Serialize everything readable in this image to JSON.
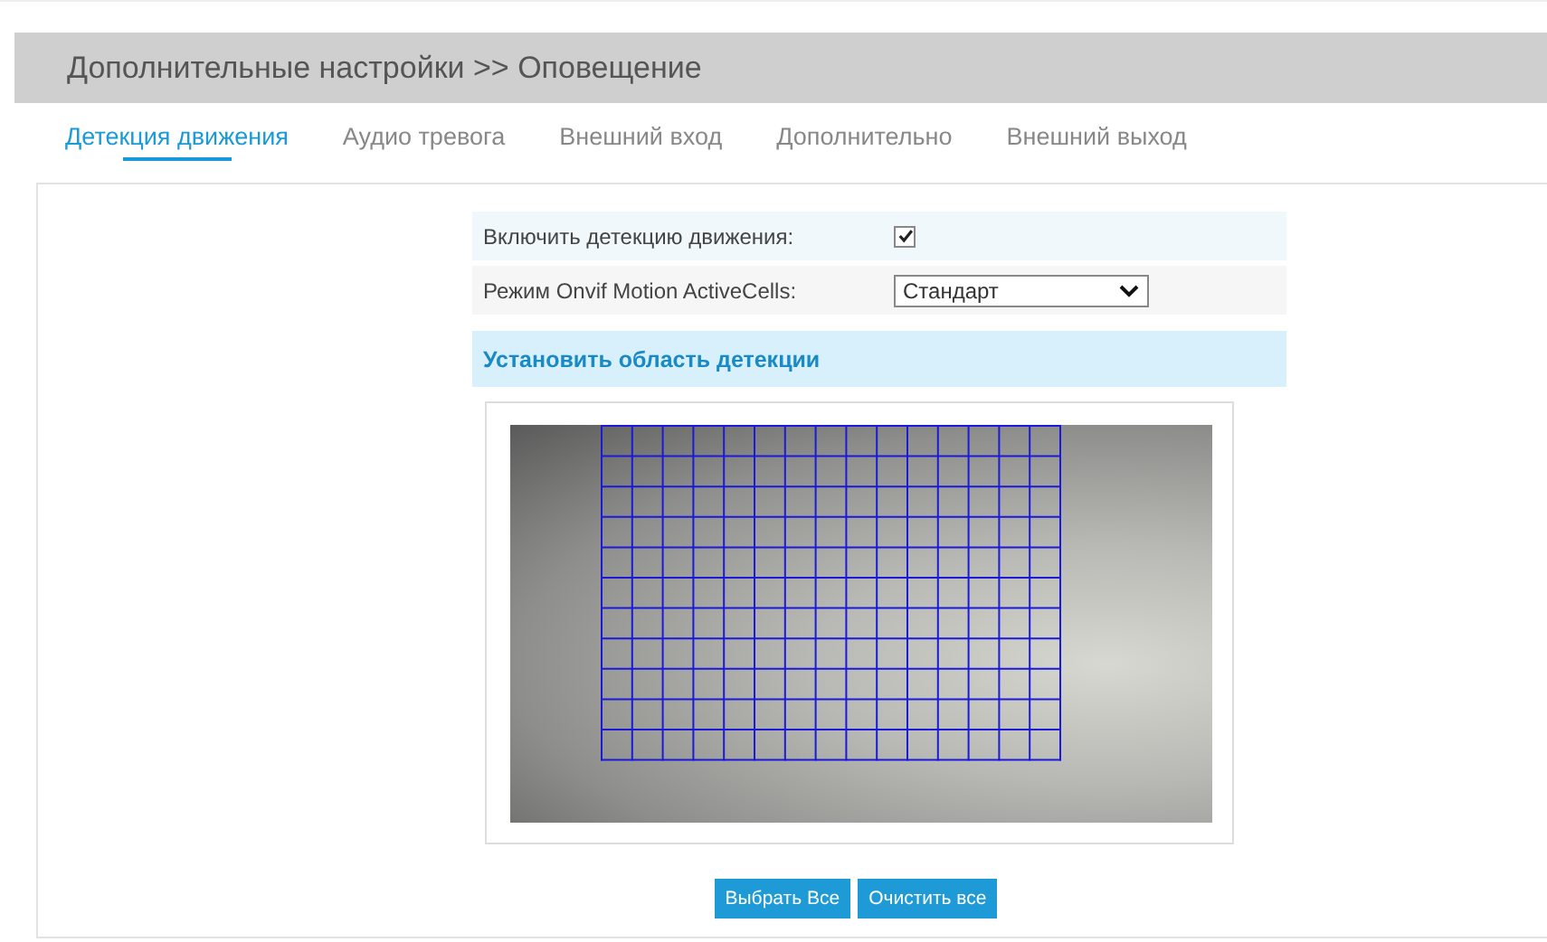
{
  "header": {
    "title": "Дополнительные настройки >> Оповещение"
  },
  "tabs": [
    {
      "label": "Детекция движения",
      "selected": true
    },
    {
      "label": "Аудио тревога",
      "selected": false
    },
    {
      "label": "Внешний вход",
      "selected": false
    },
    {
      "label": "Дополнительно",
      "selected": false
    },
    {
      "label": "Внешний выход",
      "selected": false
    }
  ],
  "settings": [
    {
      "kind": "checkbox",
      "label": "Включить детекцию движения:",
      "checked": true
    },
    {
      "kind": "select",
      "label": "Режим Onvif Motion ActiveCells:",
      "value": "Стандарт"
    }
  ],
  "detection_area": {
    "title": "Установить область детекции"
  },
  "buttons": [
    "Выбрать Все",
    "Очистить все"
  ]
}
